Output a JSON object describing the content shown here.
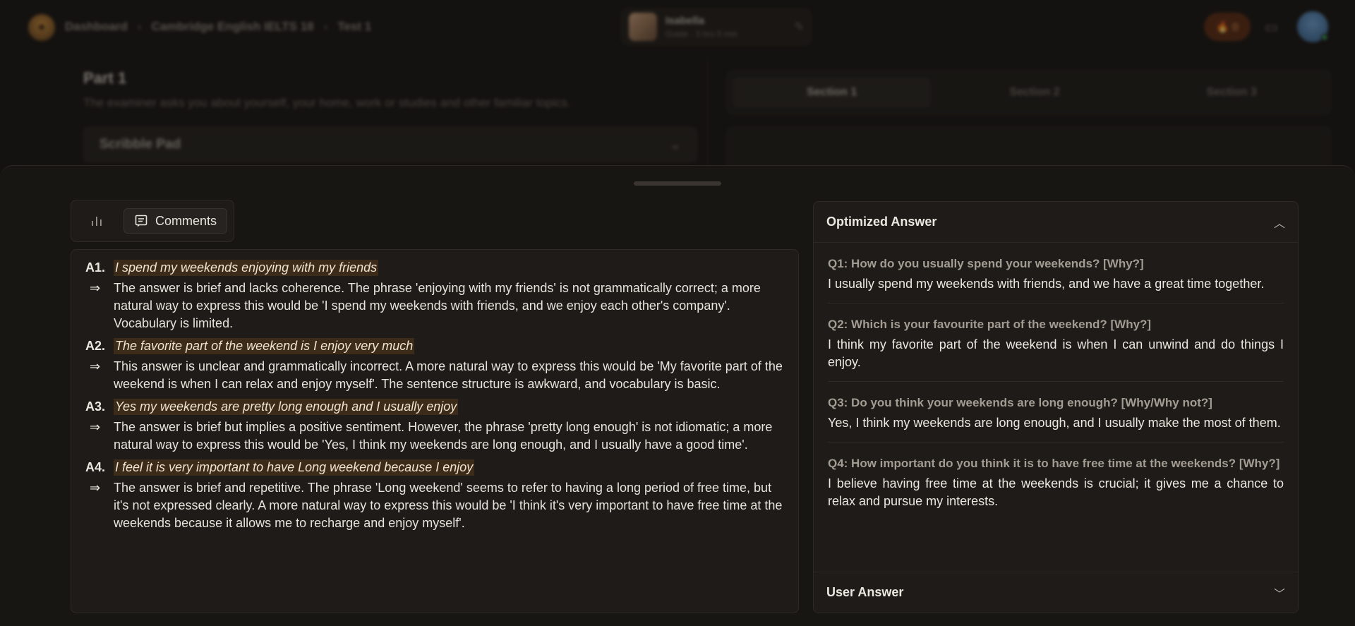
{
  "topbar": {
    "breadcrumb": [
      "Dashboard",
      "Cambridge English IELTS 18",
      "Test 1"
    ],
    "user_name": "Isabella",
    "user_sub": "Guide · 3 hrs 5 min",
    "streak_count": "0"
  },
  "background": {
    "part_title": "Part 1",
    "part_desc": "The examiner asks you about yourself, your home, work or studies and other familiar topics.",
    "scribble_label": "Scribble Pad",
    "tabs": [
      "Section 1",
      "Section 2",
      "Section 3"
    ]
  },
  "view_switch": {
    "comments_label": "Comments"
  },
  "comments": [
    {
      "label": "A1.",
      "answer": "I spend my weekends enjoying with my friends",
      "comment": "The answer is brief and lacks coherence. The phrase 'enjoying with my friends' is not grammatically correct; a more natural way to express this would be 'I spend my weekends with friends, and we enjoy each other's company'. Vocabulary is limited."
    },
    {
      "label": "A2.",
      "answer": "The favorite part of the weekend is I enjoy very much",
      "comment": "This answer is unclear and grammatically incorrect. A more natural way to express this would be 'My favorite part of the weekend is when I can relax and enjoy myself'. The sentence structure is awkward, and vocabulary is basic."
    },
    {
      "label": "A3.",
      "answer": "Yes my weekends are pretty long enough and I usually enjoy",
      "comment": "The answer is brief but implies a positive sentiment. However, the phrase 'pretty long enough' is not idiomatic; a more natural way to express this would be 'Yes, I think my weekends are long enough, and I usually have a good time'."
    },
    {
      "label": "A4.",
      "answer": "I feel it is very important to have Long weekend because I enjoy",
      "comment": "The answer is brief and repetitive. The phrase 'Long weekend' seems to refer to having a long period of free time, but it's not expressed clearly. A more natural way to express this would be 'I think it's very important to have free time at the weekends because it allows me to recharge and enjoy myself'."
    }
  ],
  "optimized": {
    "title": "Optimized Answer",
    "items": [
      {
        "q": "Q1: How do you usually spend your weekends? [Why?]",
        "a": "I usually spend my weekends with friends, and we have a great time together."
      },
      {
        "q": "Q2: Which is your favourite part of the weekend? [Why?]",
        "a": "I think my favorite part of the weekend is when I can unwind and do things I enjoy."
      },
      {
        "q": "Q3: Do you think your weekends are long enough? [Why/Why not?]",
        "a": "Yes, I think my weekends are long enough, and I usually make the most of them."
      },
      {
        "q": "Q4: How important do you think it is to have free time at the weekends? [Why?]",
        "a": "I believe having free time at the weekends is crucial; it gives me a chance to relax and pursue my interests."
      }
    ]
  },
  "user_answer": {
    "title": "User Answer"
  }
}
